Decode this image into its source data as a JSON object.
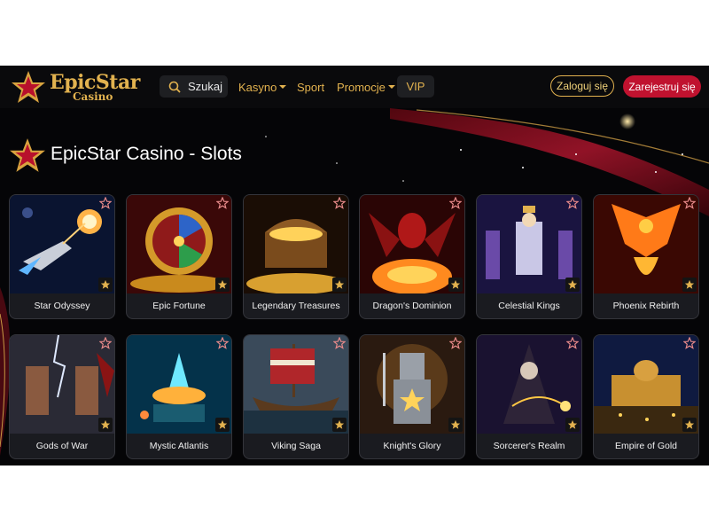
{
  "header": {
    "logo": {
      "title": "EpicStar",
      "subtitle": "Casino"
    },
    "search": {
      "label": "Szukaj",
      "icon": "search-icon"
    },
    "nav": [
      {
        "label": "Kasyno",
        "dropdown": true
      },
      {
        "label": "Sport",
        "dropdown": false
      },
      {
        "label": "Promocje",
        "dropdown": true
      }
    ],
    "vip_label": "VIP",
    "login_label": "Zaloguj się",
    "register_label": "Zarejestruj się"
  },
  "page": {
    "title": "EpicStar Casino - Slots"
  },
  "games": [
    {
      "name": "Star Odyssey",
      "theme": "space"
    },
    {
      "name": "Epic Fortune",
      "theme": "wheel"
    },
    {
      "name": "Legendary Treasures",
      "theme": "treasure"
    },
    {
      "name": "Dragon's Dominion",
      "theme": "dragon"
    },
    {
      "name": "Celestial Kings",
      "theme": "kings"
    },
    {
      "name": "Phoenix Rebirth",
      "theme": "phoenix"
    },
    {
      "name": "Gods of War",
      "theme": "gods"
    },
    {
      "name": "Mystic Atlantis",
      "theme": "atlantis"
    },
    {
      "name": "Viking Saga",
      "theme": "viking"
    },
    {
      "name": "Knight's Glory",
      "theme": "knight"
    },
    {
      "name": "Sorcerer's Realm",
      "theme": "sorcerer"
    },
    {
      "name": "Empire of Gold",
      "theme": "empire"
    }
  ],
  "colors": {
    "gold": "#e2b24f",
    "red": "#c0122f",
    "background": "#050507",
    "card": "#1a1b20"
  }
}
